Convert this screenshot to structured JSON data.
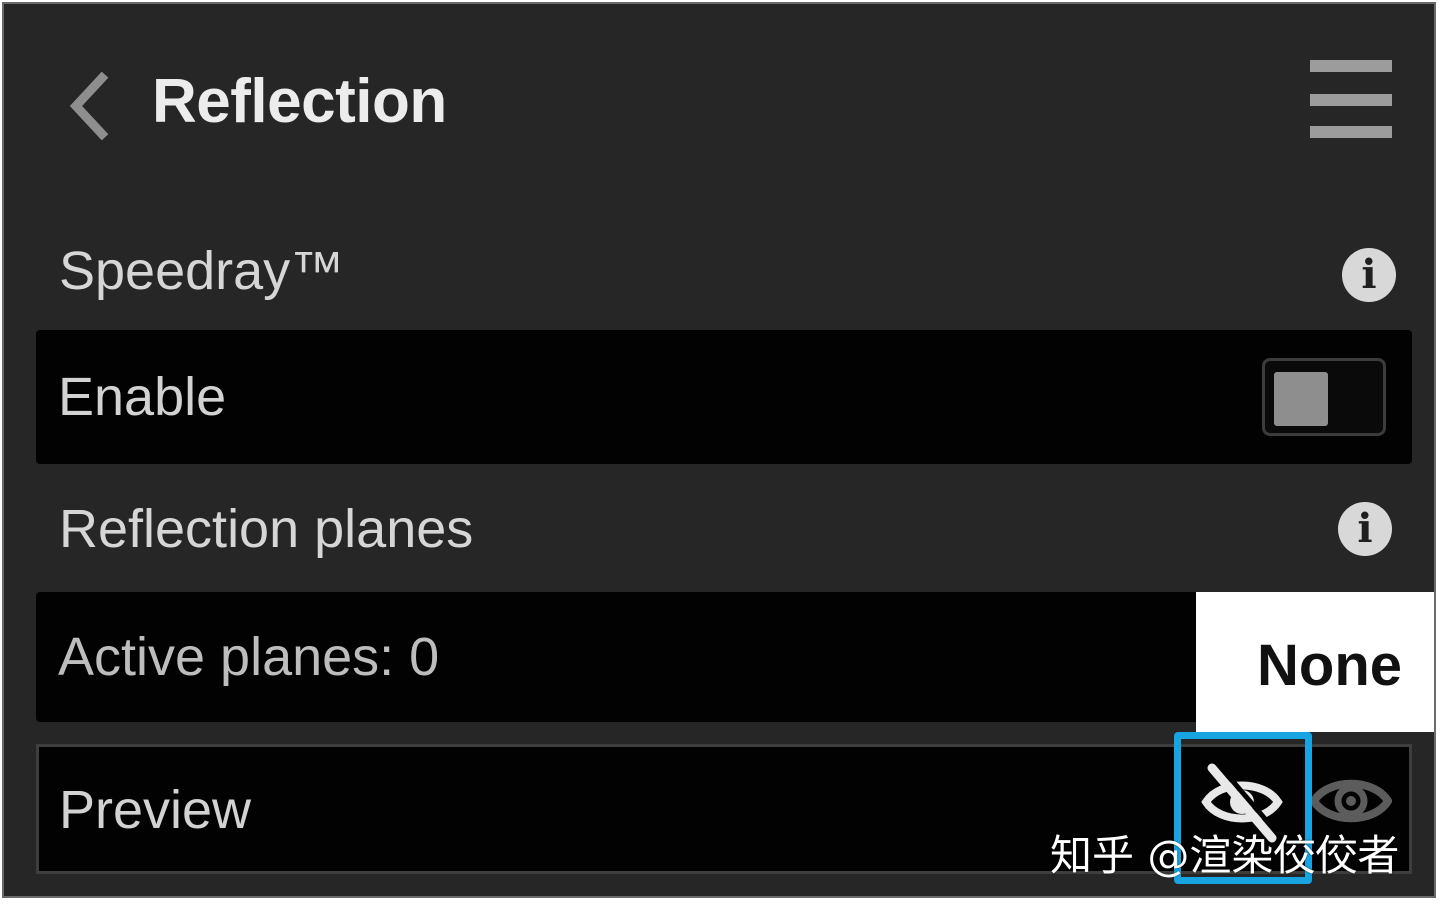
{
  "header": {
    "back_icon": "chevron-left-icon",
    "title": "Reflection",
    "menu_icon": "hamburger-menu-icon"
  },
  "speedray": {
    "label": "Speedray™",
    "info_icon": "info-icon",
    "enable_label": "Enable",
    "enable_on": false
  },
  "reflection_planes": {
    "label": "Reflection planes",
    "info_icon": "info-icon",
    "active_planes_label": "Active planes: 0",
    "selection": "None"
  },
  "preview": {
    "label": "Preview",
    "hide_icon": "eye-off-icon",
    "show_icon": "eye-icon",
    "highlight_color": "#18a4e0"
  },
  "watermark": "知乎 @渲染佼佼者",
  "colors": {
    "panel_bg": "#262626",
    "row_bg": "#020202",
    "text": "#d2d2d2"
  }
}
